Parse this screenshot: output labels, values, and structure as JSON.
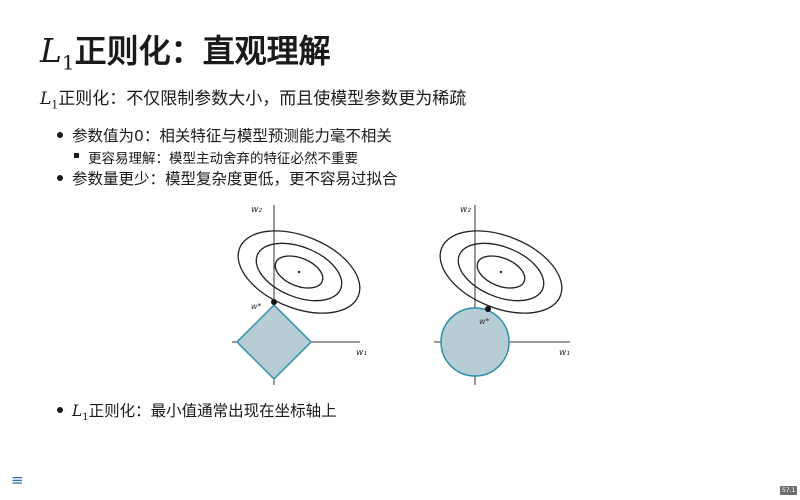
{
  "slide": {
    "title": {
      "math_base": "L",
      "math_sub": "1",
      "text": "正则化：直观理解"
    },
    "subtitle": {
      "math_base": "L",
      "math_sub": "1",
      "text": "正则化：不仅限制参数大小，而且使模型参数更为稀疏"
    },
    "bullets": [
      {
        "text": "参数值为0：相关特征与模型预测能力毫不相关"
      },
      {
        "text": "更容易理解：模型主动舍弃的特征必然不重要"
      },
      {
        "text": "参数量更少：模型复杂度更低，更不容易过拟合"
      },
      {
        "math_base": "L",
        "math_sub": "1",
        "text": "正则化：最小值通常出现在坐标轴上"
      }
    ]
  },
  "figure": {
    "left": {
      "axis_x": "w₁",
      "axis_y": "w₂",
      "point": "w*"
    },
    "right": {
      "axis_x": "w₁",
      "axis_y": "w₂",
      "point": "w*"
    },
    "colors": {
      "region_fill": "#b7cdd5",
      "region_stroke": "#2f8fa8",
      "contour": "#222222"
    }
  },
  "ui": {
    "menu_icon": "hamburger-menu-icon",
    "menu_glyph": "≡",
    "page_number": "57.1"
  }
}
